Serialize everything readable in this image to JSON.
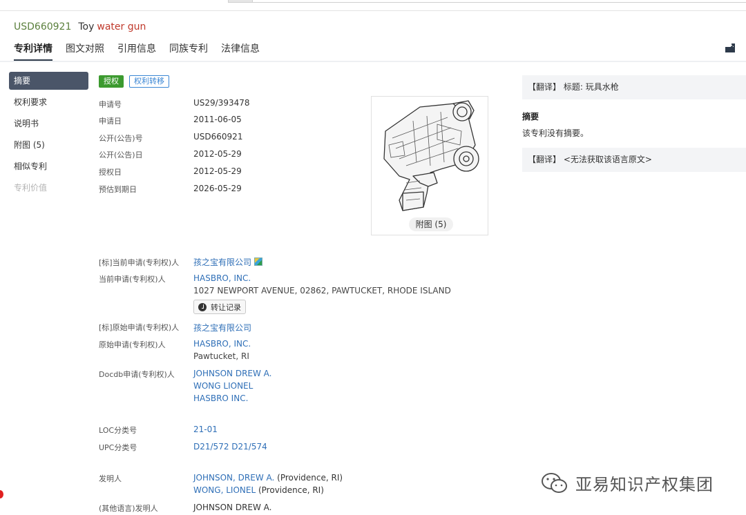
{
  "header": {
    "patent_number": "USD660921",
    "title_en_part1": "Toy",
    "title_en_part2": "water gun"
  },
  "tabs": [
    {
      "label": "专利详情",
      "active": true
    },
    {
      "label": "图文对照"
    },
    {
      "label": "引用信息"
    },
    {
      "label": "同族专利"
    },
    {
      "label": "法律信息"
    }
  ],
  "sidenav": {
    "items": [
      {
        "label": "摘要",
        "active": true
      },
      {
        "label": "权利要求"
      },
      {
        "label": "说明书"
      },
      {
        "label": "附图 (5)"
      },
      {
        "label": "相似专利"
      },
      {
        "label": "专利价值",
        "disabled": true
      }
    ]
  },
  "badges": {
    "status": "授权",
    "transfer": "权利转移"
  },
  "basic_info": [
    {
      "label": "申请号",
      "value": "US29/393478"
    },
    {
      "label": "申请日",
      "value": "2011-06-05"
    },
    {
      "label": "公开(公告)号",
      "value": "USD660921"
    },
    {
      "label": "公开(公告)日",
      "value": "2012-05-29"
    },
    {
      "label": "授权日",
      "value": "2012-05-29"
    },
    {
      "label": "预估到期日",
      "value": "2026-05-29"
    }
  ],
  "figure": {
    "caption": "附图 (5)",
    "icon": "toy-water-gun-drawing"
  },
  "parties": {
    "std_current_label": "[标]当前申请(专利权)人",
    "std_current_value": "孩之宝有限公司",
    "current_label": "当前申请(专利权)人",
    "current_name": "HASBRO, INC.",
    "current_address": "1027 NEWPORT AVENUE, 02862, PAWTUCKET, RHODE ISLAND",
    "transfer_button": "转让记录",
    "std_original_label": "[标]原始申请(专利权)人",
    "std_original_value": "孩之宝有限公司",
    "original_label": "原始申请(专利权)人",
    "original_name": "HASBRO, INC.",
    "original_address": "Pawtucket, RI",
    "docdb_label": "Docdb申请(专利权)人",
    "docdb_values": [
      "JOHNSON DREW A.",
      "WONG LIONEL",
      "HASBRO INC."
    ]
  },
  "classification": {
    "loc_label": "LOC分类号",
    "loc_value": "21-01",
    "upc_label": "UPC分类号",
    "upc_values": [
      "D21/572",
      "D21/574"
    ]
  },
  "inventors": {
    "label": "发明人",
    "list": [
      {
        "name": "JOHNSON, DREW A.",
        "place": "(Providence, RI)"
      },
      {
        "name": "WONG, LIONEL",
        "place": "(Providence, RI)"
      }
    ],
    "other_lang_label": "(其他语言)发明人",
    "other_lang_value": "JOHNSON DREW A."
  },
  "right_panel": {
    "tr1_tag": "【翻译】",
    "tr1_text": "标题: 玩具水枪",
    "abstract_title": "摘要",
    "abstract_text": "该专利没有摘要。",
    "tr2_tag": "【翻译】",
    "tr2_text": "<无法获取该语言原文>"
  },
  "watermark": {
    "text": "亚易知识产权集团",
    "icon": "wechat-icon"
  }
}
